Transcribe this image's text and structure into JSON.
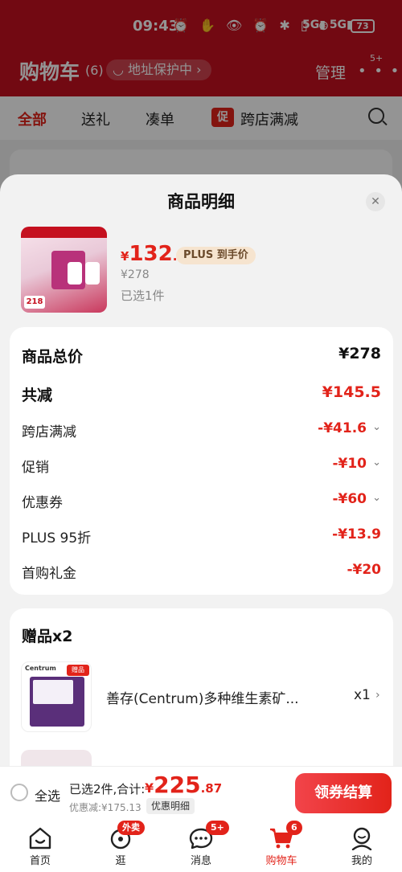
{
  "status_bar": {
    "time": "09:43",
    "signal_1": "5G",
    "signal_2": "5G",
    "battery": "73"
  },
  "header": {
    "title": "购物车",
    "count": "(6)",
    "address_pill": "地址保护中 ›",
    "manage": "管理",
    "more_badge": "5+"
  },
  "tabs": [
    {
      "label": "全部",
      "active": true
    },
    {
      "label": "送礼"
    },
    {
      "label": "凑单"
    },
    {
      "label": "跨店满减",
      "tag": "促"
    }
  ],
  "modal": {
    "title": "商品明细",
    "close_icon": "close-icon",
    "product": {
      "price_symbol": "¥",
      "price_int": "132",
      "price_dec": ".5",
      "plus_tag": "PLUS 到手价",
      "original_price": "¥278",
      "selected_count": "已选1件",
      "image_price": "218"
    },
    "breakdown": [
      {
        "label": "商品总价",
        "value": "¥278",
        "style": "big-black"
      },
      {
        "label": "共减",
        "value": "¥145.5",
        "style": "big-red"
      },
      {
        "label": "跨店满减",
        "value": "-¥41.6",
        "chevron": true
      },
      {
        "label": "促销",
        "value": "-¥10",
        "chevron": true
      },
      {
        "label": "优惠券",
        "value": "-¥60",
        "chevron": true
      },
      {
        "label": "PLUS 95折",
        "value": "-¥13.9"
      },
      {
        "label": "首购礼金",
        "value": "-¥20"
      }
    ],
    "gifts": {
      "title": "赠品x2",
      "items": [
        {
          "name": "善存(Centrum)多种维生素矿...",
          "qty": "x1",
          "brand": "Centrum",
          "image_tag": "赠品"
        }
      ]
    }
  },
  "checkout": {
    "select_all": "全选",
    "summary": "已选2件,合计:",
    "total_symbol": "¥",
    "total_int": "225",
    "total_dec": ".87",
    "discount": "优惠减:¥175.13",
    "detail_link": "优惠明细",
    "pay_button": "领券结算"
  },
  "bottom_nav": [
    {
      "label": "首页",
      "icon": "home-icon"
    },
    {
      "label": "逛",
      "icon": "browse-icon",
      "badge": "外卖"
    },
    {
      "label": "消息",
      "icon": "message-icon",
      "badge": "5+"
    },
    {
      "label": "购物车",
      "icon": "cart-icon",
      "badge": "6",
      "active": true
    },
    {
      "label": "我的",
      "icon": "profile-icon"
    }
  ],
  "colors": {
    "accent": "#e2231a",
    "header_bg": "#c5101f",
    "plus_tag_bg": "#f6e4cf"
  }
}
